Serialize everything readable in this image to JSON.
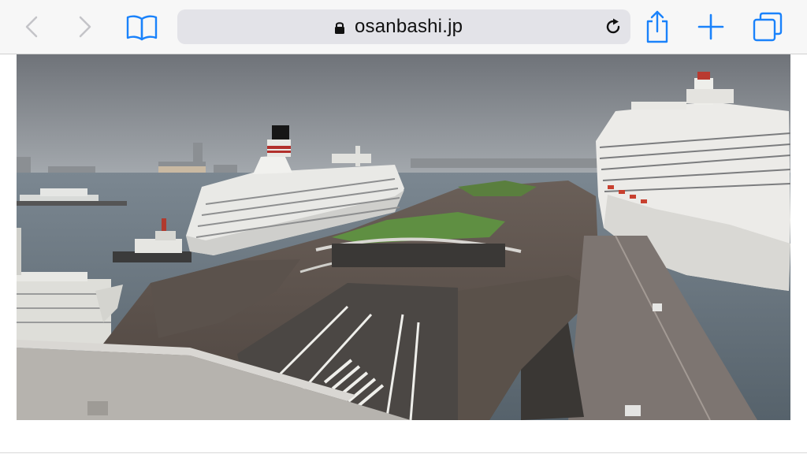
{
  "browser": {
    "url": "osanbashi.jp",
    "accent_color": "#1a82fb",
    "disabled_color": "#c4c4c8",
    "icons": {
      "back": "chevron-left-icon",
      "forward": "chevron-right-icon",
      "bookmarks": "book-icon",
      "lock": "lock-icon",
      "reload": "reload-icon",
      "share": "share-icon",
      "new_tab": "plus-icon",
      "tabs": "tabs-icon"
    }
  },
  "page": {
    "image_subject": "webcam-harbor-pier-cruise-ships"
  }
}
